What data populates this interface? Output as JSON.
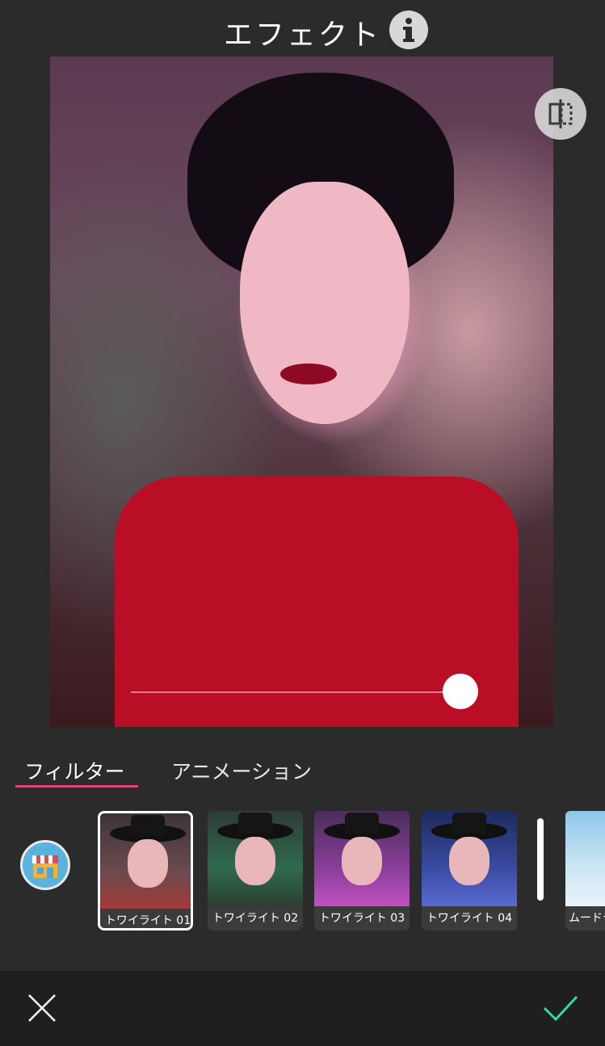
{
  "header": {
    "title": "エフェクト"
  },
  "icons": {
    "info": "info-icon",
    "compare": "compare-icon",
    "shop": "shop-icon",
    "close": "close-icon",
    "confirm": "checkmark-icon"
  },
  "slider": {
    "value": 1.0
  },
  "tabs": [
    {
      "label": "フィルター",
      "active": true
    },
    {
      "label": "アニメーション",
      "active": false
    }
  ],
  "filters": [
    {
      "label": "トワイライト 01",
      "selected": true
    },
    {
      "label": "トワイライト 02",
      "selected": false
    },
    {
      "label": "トワイライト 03",
      "selected": false
    },
    {
      "label": "トワイライト 04",
      "selected": false
    },
    {
      "label": "ムードデ",
      "selected": false
    }
  ],
  "colors": {
    "background": "#2b2b2b",
    "bottom_bar": "#1f1f1f",
    "accent": "#e0457c",
    "confirm": "#35d6a8"
  }
}
